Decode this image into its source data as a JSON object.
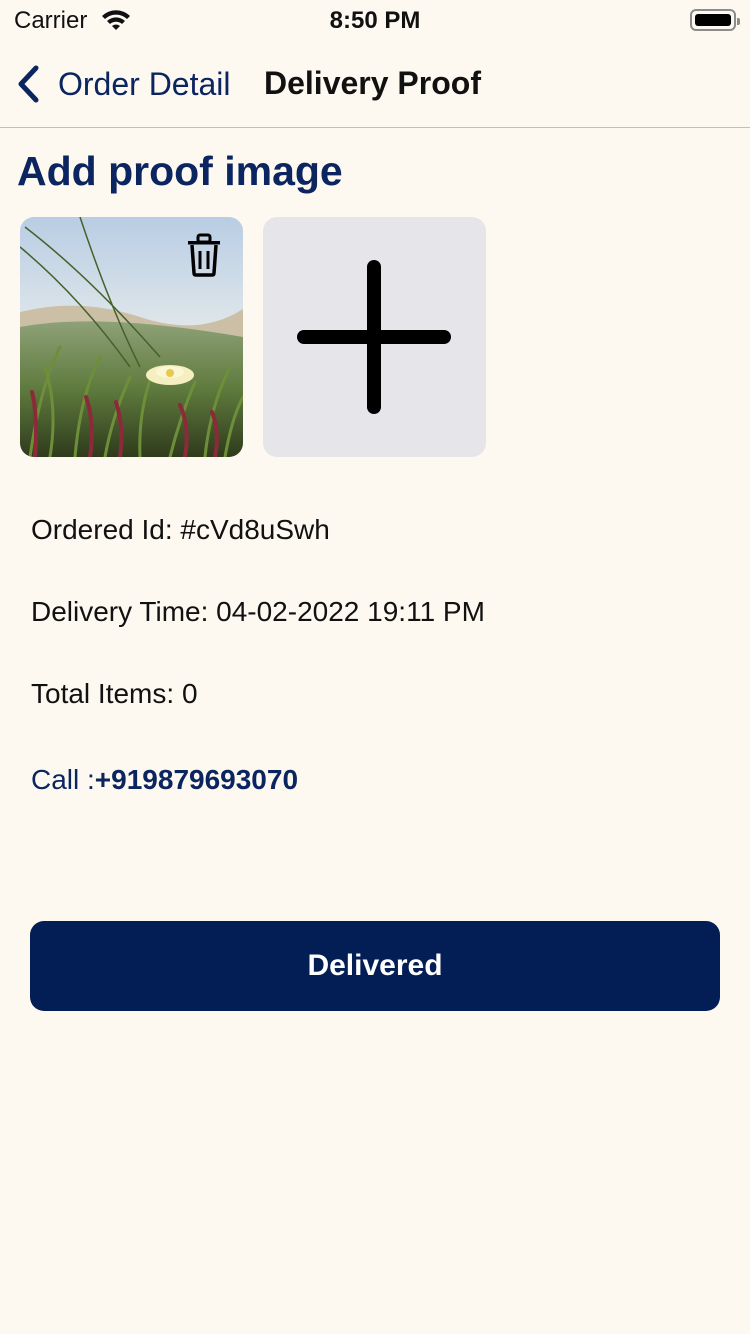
{
  "status_bar": {
    "carrier": "Carrier",
    "time": "8:50 PM"
  },
  "nav": {
    "back_label": "Order Detail",
    "title": "Delivery Proof"
  },
  "section": {
    "title": "Add proof image"
  },
  "order": {
    "id_text": "Ordered Id: #cVd8uSwh",
    "delivery_time_text": "Delivery Time: 04-02-2022 19:11 PM",
    "total_items_text": "Total Items: 0",
    "call_label": "Call :",
    "call_number": "+919879693070"
  },
  "actions": {
    "delivered_label": "Delivered"
  },
  "icons": {
    "back": "chevron-left-icon",
    "delete": "trash-icon",
    "add": "plus-icon",
    "wifi": "wifi-icon",
    "battery": "battery-icon"
  },
  "colors": {
    "background": "#fdf9f1",
    "brand_navy": "#031d55",
    "link_blue": "#0b2560",
    "add_tile": "#e6e6ea"
  }
}
